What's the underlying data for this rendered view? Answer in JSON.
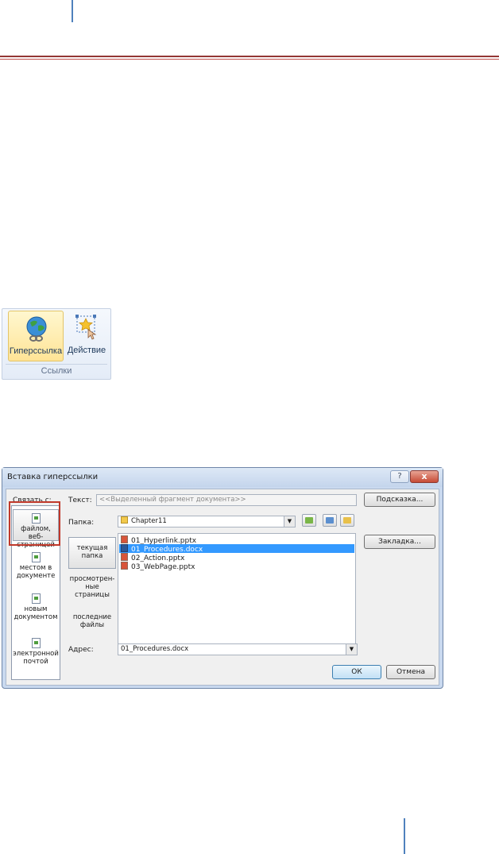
{
  "ribbon": {
    "hyperlink_label": "Гиперссылка",
    "action_label": "Действие",
    "group_label": "Ссылки"
  },
  "dialog": {
    "title": "Вставка гиперссылки",
    "help_icon": "?",
    "close_icon": "x",
    "link_to_label": "Связать с:",
    "text_label": "Текст:",
    "text_value": "<<Выделенный фрагмент документа>>",
    "hint_button": "Подсказка...",
    "folder_label": "Папка:",
    "folder_value": "Chapter11",
    "bookmark_button": "Закладка...",
    "link_to_items": [
      {
        "label": "файлом, веб-страницей",
        "icon": "file-web-icon"
      },
      {
        "label": "местом в документе",
        "icon": "place-in-document-icon"
      },
      {
        "label": "новым документом",
        "icon": "new-document-icon"
      },
      {
        "label": "электронной почтой",
        "icon": "email-icon"
      }
    ],
    "nav_items": [
      "текущая папка",
      "просмотрен-ные страницы",
      "последние файлы"
    ],
    "files": [
      {
        "name": "01_Hyperlink.pptx",
        "type": "pptx",
        "selected": false
      },
      {
        "name": "01_Procedures.docx",
        "type": "docx",
        "selected": true
      },
      {
        "name": "02_Action.pptx",
        "type": "pptx",
        "selected": false
      },
      {
        "name": "03_WebPage.pptx",
        "type": "pptx",
        "selected": false
      }
    ],
    "address_label": "Адрес:",
    "address_value": "01_Procedures.docx",
    "ok_button": "ОК",
    "cancel_button": "Отмена"
  },
  "colors": {
    "header_rule": "#943634",
    "selection": "#3399ff",
    "highlight_box": "#c0392b"
  }
}
